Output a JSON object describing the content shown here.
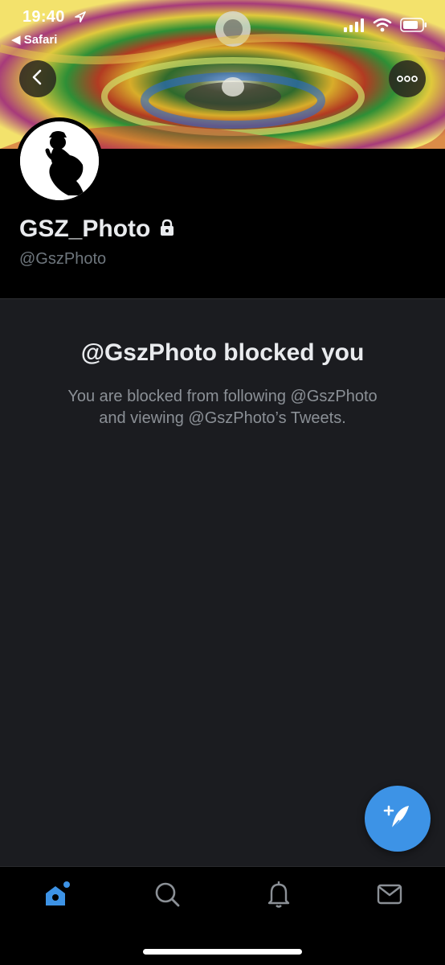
{
  "status_bar": {
    "time": "19:40",
    "back_app": "◀ Safari"
  },
  "profile": {
    "display_name": "GSZ_Photo",
    "handle": "@GszPhoto",
    "protected": true
  },
  "blocked": {
    "title": "@GszPhoto blocked you",
    "description_line1": "You are blocked from following @GszPhoto",
    "description_line2": "and viewing @GszPhoto’s Tweets."
  },
  "tabs": [
    {
      "name": "home",
      "icon": "home-icon",
      "active": true
    },
    {
      "name": "search",
      "icon": "search-icon",
      "active": false
    },
    {
      "name": "notifications",
      "icon": "bell-icon",
      "active": false
    },
    {
      "name": "messages",
      "icon": "mail-icon",
      "active": false
    }
  ],
  "colors": {
    "accent": "#3d93e6",
    "background": "#1b1c20",
    "text_primary": "#e9ebee",
    "text_secondary": "#8b9096"
  }
}
